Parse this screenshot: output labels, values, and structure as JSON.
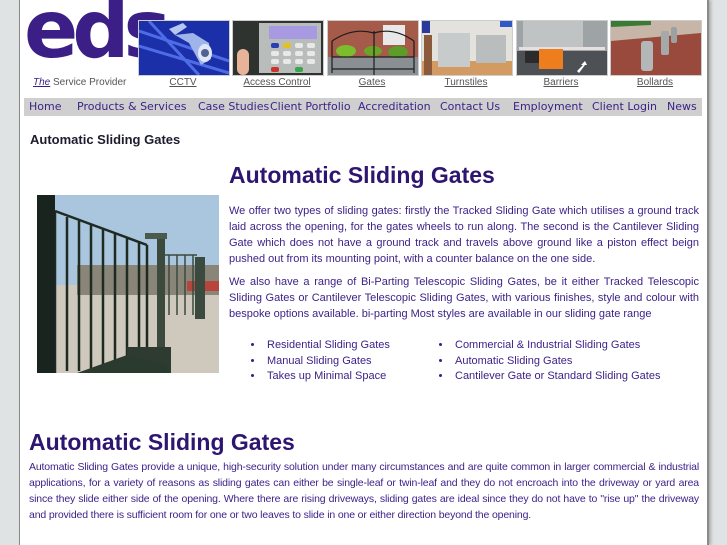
{
  "brand": {
    "logo_text": "eds",
    "tagline_the": "The",
    "tagline_rest": " Service Provider",
    "color": "#3b1f86"
  },
  "product_links": [
    {
      "label": "CCTV",
      "icon": "cctv-camera-photo"
    },
    {
      "label": "Access Control",
      "icon": "access-keypad-photo"
    },
    {
      "label": "Gates",
      "icon": "gates-photo"
    },
    {
      "label": "Turnstiles",
      "icon": "turnstiles-photo"
    },
    {
      "label": "Barriers",
      "icon": "barriers-photo"
    },
    {
      "label": "Bollards",
      "icon": "bollards-photo"
    }
  ],
  "nav": {
    "items": [
      "Home",
      "Products & Services",
      "Case Studies",
      "Client Portfolio",
      "Accreditation",
      "Contact Us",
      "Employment",
      "Client Login",
      "News"
    ]
  },
  "breadcrumb": "Automatic Sliding Gates",
  "main": {
    "title": "Automatic Sliding Gates",
    "paragraph1": "We offer two types of sliding gates: firstly the Tracked Sliding Gate which utilises a ground track laid across the opening, for the gates wheels to run along. The second is the Cantilever Sliding Gate which does not have a ground track and travels above ground like a piston effect beign pushed out from its mounting point, with a counter balance on the one side.",
    "paragraph2": "We also have a range of Bi-Parting Telescopic Sliding Gates, be it either Tracked Telescopic Sliding Gates or Cantilever Telescopic Sliding Gates, with various finishes, style and colour with bespoke options available. bi-parting Most styles are available in our sliding gate range",
    "bullets_left": [
      "Residential Sliding Gates",
      "Manual Sliding Gates",
      "Takes up Minimal Space"
    ],
    "bullets_right": [
      "Commercial & Industrial Sliding Gates",
      "Automatic Sliding Gates",
      "Cantilever Gate or Standard Sliding Gates"
    ]
  },
  "section2": {
    "title": "Automatic Sliding Gates",
    "paragraph": "Automatic Sliding Gates provide a unique, high-security solution under many circumstances and are quite common in larger commercial & industrial applications, for a variety of reasons as sliding gates can either be single-leaf or twin-leaf and they do not encroach into the driveway or yard area since they slide either side of the opening. Where there are rising driveways, sliding gates are ideal since they do not have to \"rise up\" the driveway and provided there is sufficient room for one or two leaves to slide in one or either direction beyond the opening."
  }
}
